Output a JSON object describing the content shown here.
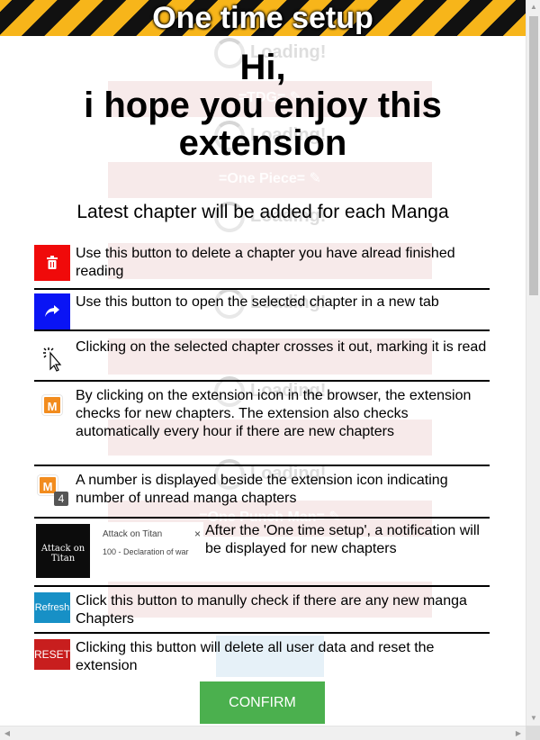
{
  "header": {
    "title": "One time setup"
  },
  "background": {
    "loading_text": "Loading!",
    "items": [
      "=TDG=",
      "=One Piece=",
      "=One Punch Man="
    ]
  },
  "intro": {
    "greeting": "Hi,",
    "message": "i hope you enjoy this extension",
    "subtitle": "Latest chapter will be added for each Manga"
  },
  "instructions": [
    {
      "icon": "trash-icon",
      "text": "Use this button to delete a chapter you have alread finished reading"
    },
    {
      "icon": "share-arrow-icon",
      "text": "Use this button to open the selected chapter in a new tab"
    },
    {
      "icon": "click-cursor-icon",
      "text": "Clicking on the selected chapter crosses it out, marking it is read"
    },
    {
      "icon": "extension-icon",
      "text": "By clicking on the extension icon in the browser, the extension checks for new chapters. The extension also checks automatically every hour if there are new chapters"
    },
    {
      "icon": "extension-badge-icon",
      "badge": "4",
      "text": "A number is displayed beside the extension icon indicating number of unread manga chapters"
    },
    {
      "icon": "notification-preview",
      "text": "After the 'One time setup', a notification will be displayed for new chapters"
    },
    {
      "icon": "refresh-button",
      "label": "Refresh",
      "text": "Click this button to manully check if there are any new manga Chapters"
    },
    {
      "icon": "reset-button",
      "label": "RESET",
      "text": "Clicking this button will delete all user data and reset the extension"
    }
  ],
  "notification": {
    "thumb_text": "Attack on Titan",
    "title": "Attack on Titan",
    "body": "100 - Declaration of war",
    "close": "×"
  },
  "extension_letter": "M",
  "confirm_label": "CONFIRM",
  "colors": {
    "stripe_yellow": "#f7b51a",
    "stripe_black": "#111111",
    "delete_red": "#f00a0a",
    "open_blue": "#0a14f5",
    "refresh_blue": "#1790c6",
    "reset_red": "#c81e1e",
    "confirm_green": "#4bb04e",
    "extension_orange": "#f28c1e"
  }
}
